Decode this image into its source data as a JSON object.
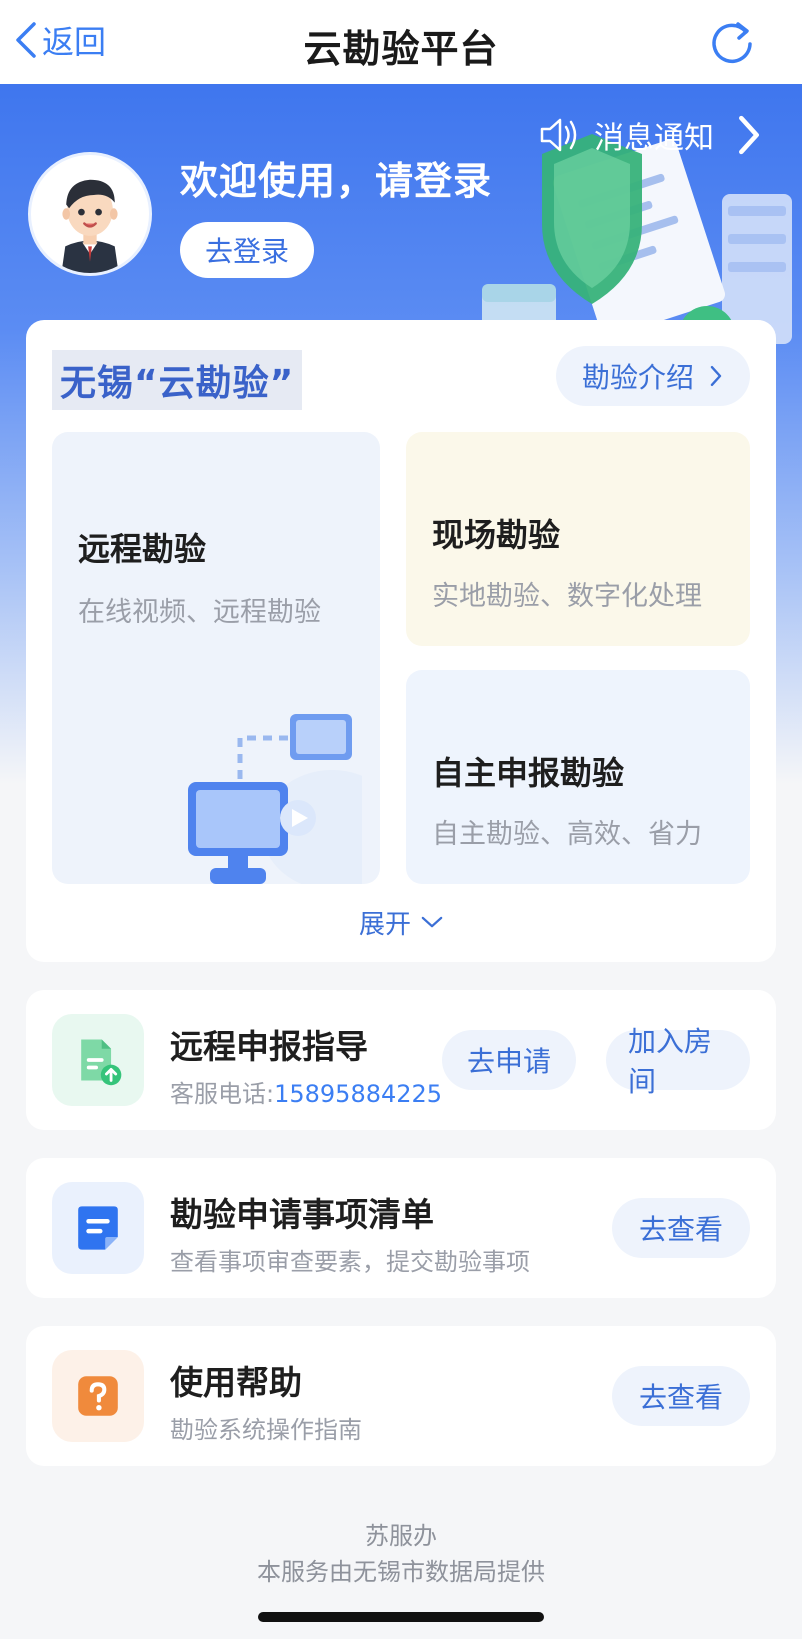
{
  "nav": {
    "back_label": "返回",
    "title": "云勘验平台"
  },
  "hero": {
    "notice_label": "消息通知",
    "welcome_text": "欢迎使用，请登录",
    "login_button": "去登录"
  },
  "main": {
    "brand_title": "无锡“云勘验”",
    "intro_button": "勘验介绍",
    "tiles": [
      {
        "title": "远程勘验",
        "subtitle": "在线视频、远程勘验"
      },
      {
        "title": "现场勘验",
        "subtitle": "实地勘验、数字化处理"
      },
      {
        "title": "自主申报勘验",
        "subtitle": "自主勘验、高效、省力"
      }
    ],
    "expand_label": "展开"
  },
  "services": [
    {
      "title": "远程申报指导",
      "subtitle_prefix": "客服电话:",
      "phone": "15895884225",
      "buttons": [
        "去申请",
        "加入房间"
      ]
    },
    {
      "title": "勘验申请事项清单",
      "subtitle": "查看事项审查要素，提交勘验事项",
      "buttons": [
        "去查看"
      ]
    },
    {
      "title": "使用帮助",
      "subtitle": "勘验系统操作指南",
      "buttons": [
        "去查看"
      ]
    }
  ],
  "footer": {
    "line1": "苏服办",
    "line2": "本服务由无锡市数据局提供"
  },
  "icons": {
    "back": "chevron-left-icon",
    "refresh": "refresh-icon",
    "notice": "speaker-icon",
    "service_1": "document-upload-icon",
    "service_2": "list-document-icon",
    "service_3": "question-icon"
  },
  "colors": {
    "accent": "#3b7ef3",
    "hero_top": "#3f76ee",
    "service_1": "#35c47a",
    "service_2": "#2f74f0",
    "service_3": "#f08a3c"
  }
}
